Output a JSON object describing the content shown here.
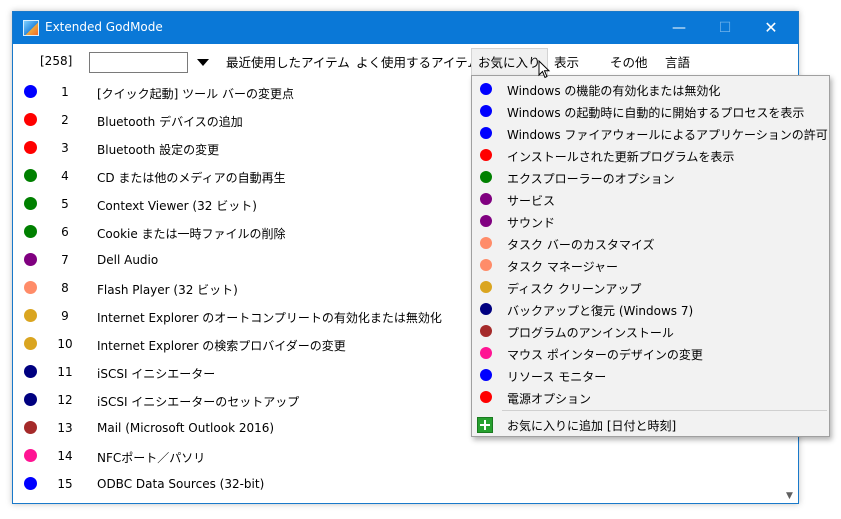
{
  "window": {
    "title": "Extended GodMode",
    "controls": {
      "minimize": "—",
      "maximize": "☐",
      "close": "✕"
    }
  },
  "toolbar": {
    "count": "[258]",
    "search_value": "",
    "menus": [
      "最近使用したアイテム",
      "よく使用するアイテム",
      "お気に入り",
      "表示",
      "その他",
      "言語"
    ],
    "active_menu": "お気に入り"
  },
  "list": [
    {
      "num": "1",
      "label": "[クイック起動] ツール バーの変更点",
      "color": "#0000ff"
    },
    {
      "num": "2",
      "label": "Bluetooth デバイスの追加",
      "color": "#ff0000"
    },
    {
      "num": "3",
      "label": "Bluetooth 設定の変更",
      "color": "#ff0000"
    },
    {
      "num": "4",
      "label": "CD または他のメディアの自動再生",
      "color": "#008000"
    },
    {
      "num": "5",
      "label": "Context Viewer (32 ビット)",
      "color": "#008000"
    },
    {
      "num": "6",
      "label": "Cookie または一時ファイルの削除",
      "color": "#008000"
    },
    {
      "num": "7",
      "label": "Dell Audio",
      "color": "#800080"
    },
    {
      "num": "8",
      "label": "Flash Player (32 ビット)",
      "color": "#ff8c69"
    },
    {
      "num": "9",
      "label": "Internet Explorer のオートコンプリートの有効化または無効化",
      "color": "#daa520"
    },
    {
      "num": "10",
      "label": "Internet Explorer の検索プロバイダーの変更",
      "color": "#daa520"
    },
    {
      "num": "11",
      "label": "iSCSI イニシエーター",
      "color": "#000080"
    },
    {
      "num": "12",
      "label": "iSCSI イニシエーターのセットアップ",
      "color": "#000080"
    },
    {
      "num": "13",
      "label": "Mail (Microsoft Outlook 2016)",
      "color": "#a52a2a"
    },
    {
      "num": "14",
      "label": "NFCポート／パソリ",
      "color": "#ff1493"
    },
    {
      "num": "15",
      "label": "ODBC Data Sources (32-bit)",
      "color": "#0000ff"
    }
  ],
  "favorites_menu": {
    "items": [
      {
        "label": "Windows の機能の有効化または無効化",
        "color": "#0000ff"
      },
      {
        "label": "Windows の起動時に自動的に開始するプロセスを表示",
        "color": "#0000ff"
      },
      {
        "label": "Windows ファイアウォールによるアプリケーションの許可",
        "color": "#0000ff"
      },
      {
        "label": "インストールされた更新プログラムを表示",
        "color": "#ff0000"
      },
      {
        "label": "エクスプローラーのオプション",
        "color": "#008000"
      },
      {
        "label": "サービス",
        "color": "#800080"
      },
      {
        "label": "サウンド",
        "color": "#800080"
      },
      {
        "label": "タスク バーのカスタマイズ",
        "color": "#ff8c69"
      },
      {
        "label": "タスク マネージャー",
        "color": "#ff8c69"
      },
      {
        "label": "ディスク クリーンアップ",
        "color": "#daa520"
      },
      {
        "label": "バックアップと復元 (Windows 7)",
        "color": "#000080"
      },
      {
        "label": "プログラムのアンインストール",
        "color": "#a52a2a"
      },
      {
        "label": "マウス ポインターのデザインの変更",
        "color": "#ff1493"
      },
      {
        "label": "リソース モニター",
        "color": "#0000ff"
      },
      {
        "label": "電源オプション",
        "color": "#ff0000"
      }
    ],
    "add_label": "お気に入りに追加 [日付と時刻]"
  }
}
